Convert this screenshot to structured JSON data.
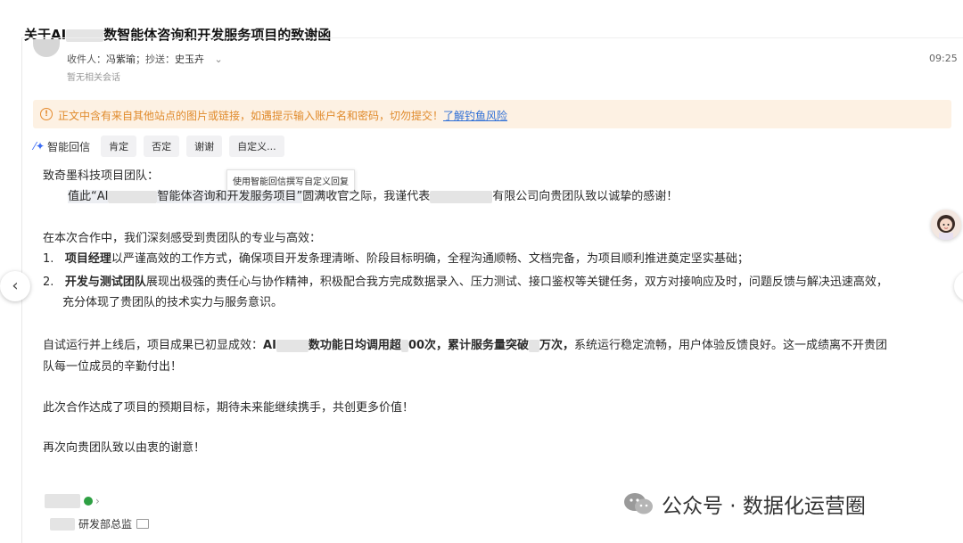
{
  "email": {
    "subject_prefix": "关于AI",
    "subject_suffix": "数智能体咨询和开发服务项目的致谢函",
    "recipients_label": "收件人：",
    "recipient": "冯紫瑜",
    "cc_label": "；抄送：",
    "cc": "史玉卉",
    "time": "09:25",
    "no_related": "暂无相关会话"
  },
  "warning": {
    "text": "正文中含有来自其他站点的图片或链接，如遇提示输入账户名和密码，切勿提交！",
    "link": "了解钓鱼风险"
  },
  "smart_reply": {
    "label": "智能回信",
    "chips": [
      "肯定",
      "否定",
      "谢谢",
      "自定义..."
    ],
    "tooltip": "使用智能回信撰写自定义回复"
  },
  "body": {
    "greeting": "致奇墨科技项目团队：",
    "p1_a": "值此“AI",
    "p1_b": "智能体咨询和开发服务项目”",
    "p1_c": "圆满收官之际，我谨代表",
    "p1_d": "有限公司向贵团队致以诚挚的感谢！",
    "intro": "在本次合作中，我们深刻感受到贵团队的专业与高效：",
    "item1_num": "1.",
    "item1_bold": "项目经理",
    "item1_text": "以严谨高效的工作方式，确保项目开发条理清晰、阶段目标明确，全程沟通顺畅、文档完备，为项目顺利推进奠定坚实基础；",
    "item2_num": "2.",
    "item2_bold": "开发与测试团队",
    "item2_text": "展现出极强的责任心与协作精神，积极配合我方完成数据录入、压力测试、接口鉴权等关键任务，双方对接响应及时，问题反馈与解决迅速高效，",
    "item2_text2": "充分体现了贵团队的技术实力与服务意识。",
    "result_a": "自试运行并上线后，项目成果已初显成效：",
    "result_b": "AI",
    "result_c": "数功能日均调用超",
    "result_d": "00次，累计服务量突破",
    "result_e": "万次，",
    "result_f": "系统运行稳定流畅，用户体验反馈良好。这一成绩离不开贵团",
    "result_g": "队每一位成员的辛勤付出！",
    "p_goal": "此次合作达成了项目的预期目标，期待未来能继续携手，共创更多价值！",
    "p_thanks": "再次向贵团队致以由衷的谢意！"
  },
  "signature": {
    "title": "研发部总监"
  },
  "watermark": {
    "text": "公众号 · 数据化运营圈"
  },
  "colors": {
    "warning_bg": "#fdf1e3",
    "warning_text": "#e08a2b",
    "link": "#2f6fd6",
    "accent": "#3b6cf5"
  }
}
